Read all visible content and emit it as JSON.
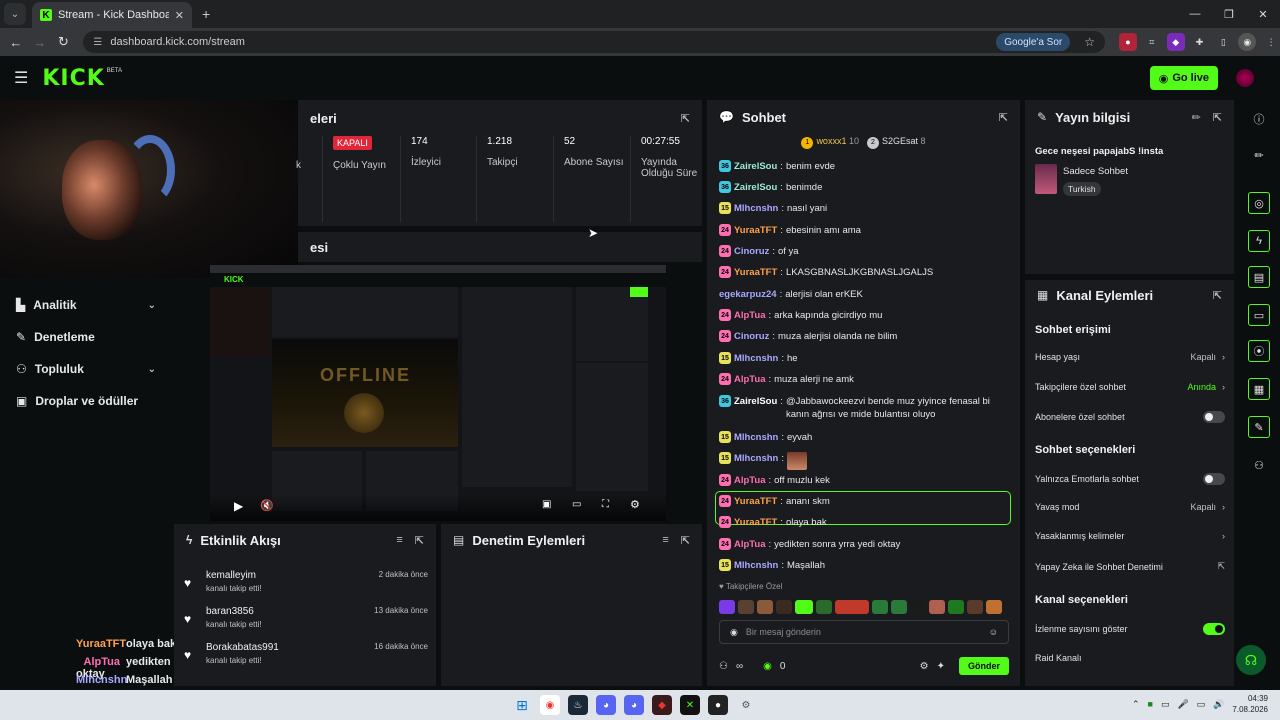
{
  "browser": {
    "tab_title": "Stream - Kick Dashboard",
    "url": "dashboard.kick.com/stream",
    "google_sor": "Google'a Sor"
  },
  "header": {
    "logo": "KICK",
    "beta": "BETA",
    "go_live": "Go live"
  },
  "sidebar": {
    "items": [
      {
        "label": "Analitik",
        "icon": "chart-icon",
        "has_chevron": true
      },
      {
        "label": "Denetleme",
        "icon": "wrench-icon",
        "has_chevron": false
      },
      {
        "label": "Topluluk",
        "icon": "users-icon",
        "has_chevron": true
      },
      {
        "label": "Droplar ve ödüller",
        "icon": "gift-icon",
        "has_chevron": false
      }
    ]
  },
  "webcam_chat_overlay": [
    {
      "user": "YuraaTFT",
      "text": "olaya bak",
      "color": "#ffa24c"
    },
    {
      "user": "AlpTua",
      "text": "yedikten sonra yrra yedi oktay",
      "color": "#ff6fb2"
    },
    {
      "user": "Mlhcnshn",
      "text": "Maşallah",
      "color": "#a9a7ff"
    }
  ],
  "stats": {
    "title_fragment": "eleri",
    "items": [
      {
        "value": "",
        "label": "k"
      },
      {
        "value": "KAPALI",
        "label": "Çoklu Yayın"
      },
      {
        "value": "174",
        "label": "İzleyici"
      },
      {
        "value": "1.218",
        "label": "Takipçi"
      },
      {
        "value": "52",
        "label": "Abone Sayısı"
      },
      {
        "value": "00:27:55",
        "label": "Yayında Olduğu Süre"
      }
    ]
  },
  "preview": {
    "title_fragment": "esi"
  },
  "activity": {
    "title": "Etkinlik Akışı",
    "items": [
      {
        "user": "kemalleyim",
        "action": "kanalı takip etti!",
        "time": "2 dakika önce"
      },
      {
        "user": "baran3856",
        "action": "kanalı takip etti!",
        "time": "13 dakika önce"
      },
      {
        "user": "Borakabatas991",
        "action": "kanalı takip etti!",
        "time": "16 dakika önce"
      }
    ]
  },
  "moderation": {
    "title": "Denetim Eylemleri"
  },
  "chat": {
    "title": "Sohbet",
    "top_chatters": [
      {
        "name": "woxxx1",
        "count": "10",
        "rank": "1",
        "color": "#f5b400"
      },
      {
        "name": "S2GEsat",
        "count": "8",
        "rank": "2",
        "color": "#c7c9cc"
      }
    ],
    "messages": [
      {
        "badge": "36",
        "badge_color": "#40c8e0",
        "user": "ZairelSou",
        "user_color": "#9be9d6",
        "text": "benim evde"
      },
      {
        "badge": "36",
        "badge_color": "#40c8e0",
        "user": "ZairelSou",
        "user_color": "#9be9d6",
        "text": "benimde"
      },
      {
        "badge": "15",
        "badge_color": "#e8e25a",
        "user": "Mlhcnshn",
        "user_color": "#a9a7ff",
        "text": "nasıl yani"
      },
      {
        "badge": "24",
        "badge_color": "#ff6fb2",
        "user": "YuraaTFT",
        "user_color": "#ffa24c",
        "text": "ebesinin amı ama"
      },
      {
        "badge": "24",
        "badge_color": "#ff6fb2",
        "user": "Cinoruz",
        "user_color": "#a9a7ff",
        "text": "of ya"
      },
      {
        "badge": "24",
        "badge_color": "#ff6fb2",
        "user": "YuraaTFT",
        "user_color": "#ffa24c",
        "text": "LKASGBNASLJKGBNASLJGALJS"
      },
      {
        "badge": "",
        "badge_color": "",
        "user": "egekarpuz24",
        "user_color": "#a9a7ff",
        "text": "alerjisi olan erKEK"
      },
      {
        "badge": "24",
        "badge_color": "#ff6fb2",
        "user": "AlpTua",
        "user_color": "#ff6fb2",
        "text": "arka kapında gicirdiyo mu"
      },
      {
        "badge": "24",
        "badge_color": "#ff6fb2",
        "user": "Cinoruz",
        "user_color": "#a9a7ff",
        "text": "muza alerjisi olanda ne bilim"
      },
      {
        "badge": "15",
        "badge_color": "#e8e25a",
        "user": "Mlhcnshn",
        "user_color": "#a9a7ff",
        "text": "he"
      },
      {
        "badge": "24",
        "badge_color": "#ff6fb2",
        "user": "AlpTua",
        "user_color": "#ff6fb2",
        "text": "muza alerji ne amk"
      },
      {
        "badge": "36",
        "badge_color": "#40c8e0",
        "user": "ZairelSou",
        "user_color": "#ffffff",
        "text": "@Jabbawockeezvi bende muz yiyince fenasal bi kanın ağrısı ve mide bulantısı oluyo"
      },
      {
        "badge": "15",
        "badge_color": "#e8e25a",
        "user": "Mlhcnshn",
        "user_color": "#a9a7ff",
        "text": "eyvah"
      },
      {
        "badge": "15",
        "badge_color": "#e8e25a",
        "user": "Mlhcnshn",
        "user_color": "#a9a7ff",
        "text": ""
      },
      {
        "badge": "24",
        "badge_color": "#ff6fb2",
        "user": "AlpTua",
        "user_color": "#ff6fb2",
        "text": "off muzlu kek"
      },
      {
        "badge": "24",
        "badge_color": "#ff6fb2",
        "user": "YuraaTFT",
        "user_color": "#ffa24c",
        "text": "ananı skm"
      },
      {
        "badge": "24",
        "badge_color": "#ff6fb2",
        "user": "YuraaTFT",
        "user_color": "#ffa24c",
        "text": "olaya bak"
      },
      {
        "badge": "24",
        "badge_color": "#ff6fb2",
        "user": "AlpTua",
        "user_color": "#ff6fb2",
        "text": "yedikten sonra yrra yedi oktay"
      },
      {
        "badge": "15",
        "badge_color": "#e8e25a",
        "user": "Mlhcnshn",
        "user_color": "#a9a7ff",
        "text": "Maşallah"
      }
    ],
    "followers_only": "Takipçilere Özel",
    "placeholder": "Bir mesaj gönderin",
    "infinity": "∞",
    "points": "0",
    "send": "Gönder"
  },
  "stream_info": {
    "title": "Yayın bilgisi",
    "stream_title": "Gece neşesi papajabS !insta",
    "category": "Sadece Sohbet",
    "language": "Turkish"
  },
  "channel_actions": {
    "title": "Kanal Eylemleri",
    "chat_access": "Sohbet erişimi",
    "account_age": "Hesap yaşı",
    "account_age_val": "Kapalı",
    "followers_chat": "Takipçilere özel sohbet",
    "followers_chat_val": "Anında",
    "subs_chat": "Abonelere özel sohbet",
    "chat_options": "Sohbet seçenekleri",
    "emote_only": "Yalnızca Emotlarla sohbet",
    "slow_mode": "Yavaş mod",
    "slow_mode_val": "Kapalı",
    "banned_words": "Yasaklanmış kelimeler",
    "ai_mod": "Yapay Zeka ile Sohbet Denetimi",
    "channel_options": "Kanal seçenekleri",
    "show_viewers": "İzlenme sayısını göster",
    "raid": "Raid Kanalı"
  },
  "taskbar": {
    "time": "04:39",
    "date": "7.08.2026"
  },
  "colors": {
    "accent": "#53fc18",
    "panel": "#191b1f",
    "bg": "#0b0e0f",
    "live_red": "#e0263a"
  }
}
